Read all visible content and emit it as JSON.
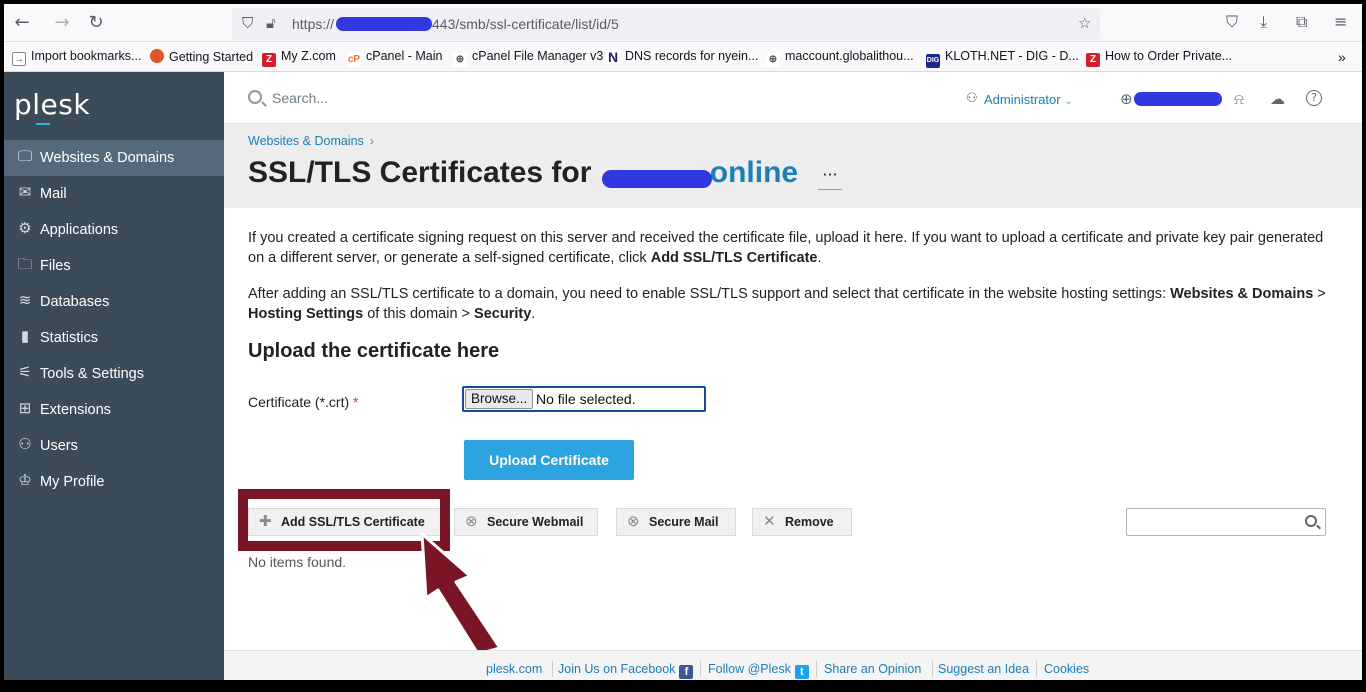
{
  "browser": {
    "url": "https://",
    "url_tail": "443/smb/ssl-certificate/list/id/5"
  },
  "bookmarks": [
    {
      "label": "Import bookmarks...",
      "icon": "import-icon",
      "color": "#555555"
    },
    {
      "label": "Getting Started",
      "icon": "firefox-icon",
      "color": "#e2542a"
    },
    {
      "label": "My Z.com",
      "icon": "zcom-icon",
      "color": "#d21f2c"
    },
    {
      "label": "cPanel - Main",
      "icon": "cpanel-icon",
      "color": "#ff6c2c"
    },
    {
      "label": "cPanel File Manager v3",
      "icon": "globe-icon",
      "color": "#555555"
    },
    {
      "label": "DNS records for nyein...",
      "icon": "namecheap-n-icon",
      "color": "#2c1a6e"
    },
    {
      "label": "maccount.globalithou...",
      "icon": "globe-icon",
      "color": "#555555"
    },
    {
      "label": "KLOTH.NET - DIG - D...",
      "icon": "kloth-icon",
      "color": "#1a2a8a"
    },
    {
      "label": "How to Order Private...",
      "icon": "zcom-icon",
      "color": "#d21f2c"
    }
  ],
  "sidebar": {
    "logo": "plesk",
    "items": [
      {
        "label": "Websites & Domains",
        "icon": "monitor-icon",
        "glyph": "🖵"
      },
      {
        "label": "Mail",
        "icon": "mail-icon",
        "glyph": "✉"
      },
      {
        "label": "Applications",
        "icon": "gear-icon",
        "glyph": "⚙"
      },
      {
        "label": "Files",
        "icon": "folder-icon",
        "glyph": "🗀"
      },
      {
        "label": "Databases",
        "icon": "database-icon",
        "glyph": "≋"
      },
      {
        "label": "Statistics",
        "icon": "bar-chart-icon",
        "glyph": "▮"
      },
      {
        "label": "Tools & Settings",
        "icon": "sliders-icon",
        "glyph": "⚟"
      },
      {
        "label": "Extensions",
        "icon": "extensions-icon",
        "glyph": "⊞"
      },
      {
        "label": "Users",
        "icon": "user-icon",
        "glyph": "⚇"
      },
      {
        "label": "My Profile",
        "icon": "profile-icon",
        "glyph": "♔"
      }
    ]
  },
  "header": {
    "search_placeholder": "Search...",
    "user": "Administrator"
  },
  "page": {
    "breadcrumb": "Websites & Domains",
    "title_prefix": "SSL/TLS Certificates for",
    "title_domain": "online",
    "more": "···",
    "para1_a": "If you created a certificate signing request on this server and received the certificate file, upload it here. If you want to upload a certificate and private key pair generated on a different server, or generate a self-signed certificate, click ",
    "para1_b": "Add SSL/TLS Certificate",
    "para1_c": ".",
    "para2_a": "After adding an SSL/TLS certificate to a domain, you need to enable SSL/TLS support and select that certificate in the website hosting settings: ",
    "para2_b": "Websites & Domains",
    "para2_c": " > ",
    "para2_d": "Hosting Settings",
    "para2_e": " of this domain > ",
    "para2_f": "Security",
    "para2_g": ".",
    "upload_title": "Upload the certificate here",
    "cert_label": "Certificate (*.crt)",
    "required_mark": "*",
    "browse_label": "Browse...",
    "no_file": "No file selected.",
    "upload_button": "Upload Certificate",
    "toolbar": {
      "add": "Add SSL/TLS Certificate",
      "webmail": "Secure Webmail",
      "mail": "Secure Mail",
      "remove": "Remove"
    },
    "no_items": "No items found."
  },
  "footer": {
    "links": [
      "plesk.com",
      "Join Us on Facebook",
      "Follow @Plesk",
      "Share an Opinion",
      "Suggest an Idea",
      "Cookies"
    ]
  },
  "colors": {
    "sidebar_bg": "#3b4b58",
    "accent": "#2aa3de",
    "link": "#1d7fb7",
    "highlight": "#7a1526"
  }
}
